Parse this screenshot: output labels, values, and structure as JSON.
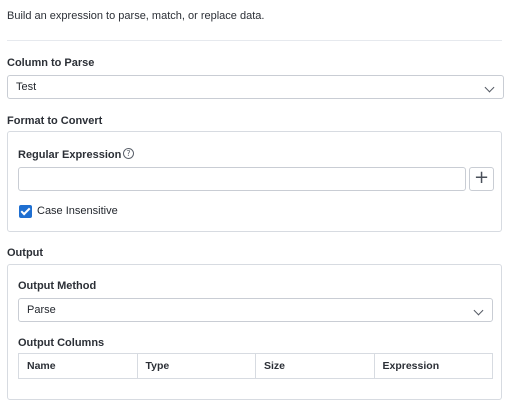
{
  "intro_text": "Build an expression to parse, match, or replace data.",
  "column_to_parse": {
    "label": "Column to Parse",
    "selected": "Test"
  },
  "format_to_convert": {
    "label": "Format to Convert",
    "regex_label": "Regular Expression",
    "help_icon": "?",
    "regex_value": "",
    "add_button": "+",
    "case_insensitive_label": "Case Insensitive",
    "case_insensitive_checked": true
  },
  "output": {
    "label": "Output",
    "method_label": "Output Method",
    "method_selected": "Parse",
    "columns_label": "Output Columns",
    "columns": [
      "Name",
      "Type",
      "Size",
      "Expression"
    ]
  },
  "colors": {
    "accent": "#1f6fd1",
    "border": "#c9cdd4"
  }
}
